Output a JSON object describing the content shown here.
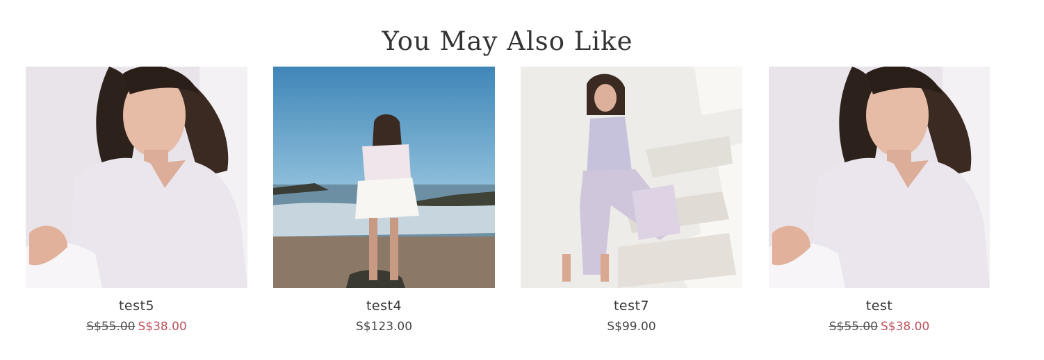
{
  "section": {
    "heading": "You May Also Like"
  },
  "products": [
    {
      "image": "woman-in-lilac-vneck-top-photo",
      "name": "test5",
      "compare_price": "S$55.00",
      "price": "S$38.00"
    },
    {
      "image": "woman-on-beach-photo",
      "name": "test4",
      "price": "S$123.00"
    },
    {
      "image": "woman-in-pastel-jumpsuit-on-stairs-photo",
      "name": "test7",
      "price": "S$99.00"
    },
    {
      "image": "woman-in-lilac-vneck-top-photo",
      "name": "test",
      "compare_price": "S$55.00",
      "price": "S$38.00"
    }
  ],
  "colors": {
    "sale": "#c0505a",
    "text": "#333333"
  }
}
